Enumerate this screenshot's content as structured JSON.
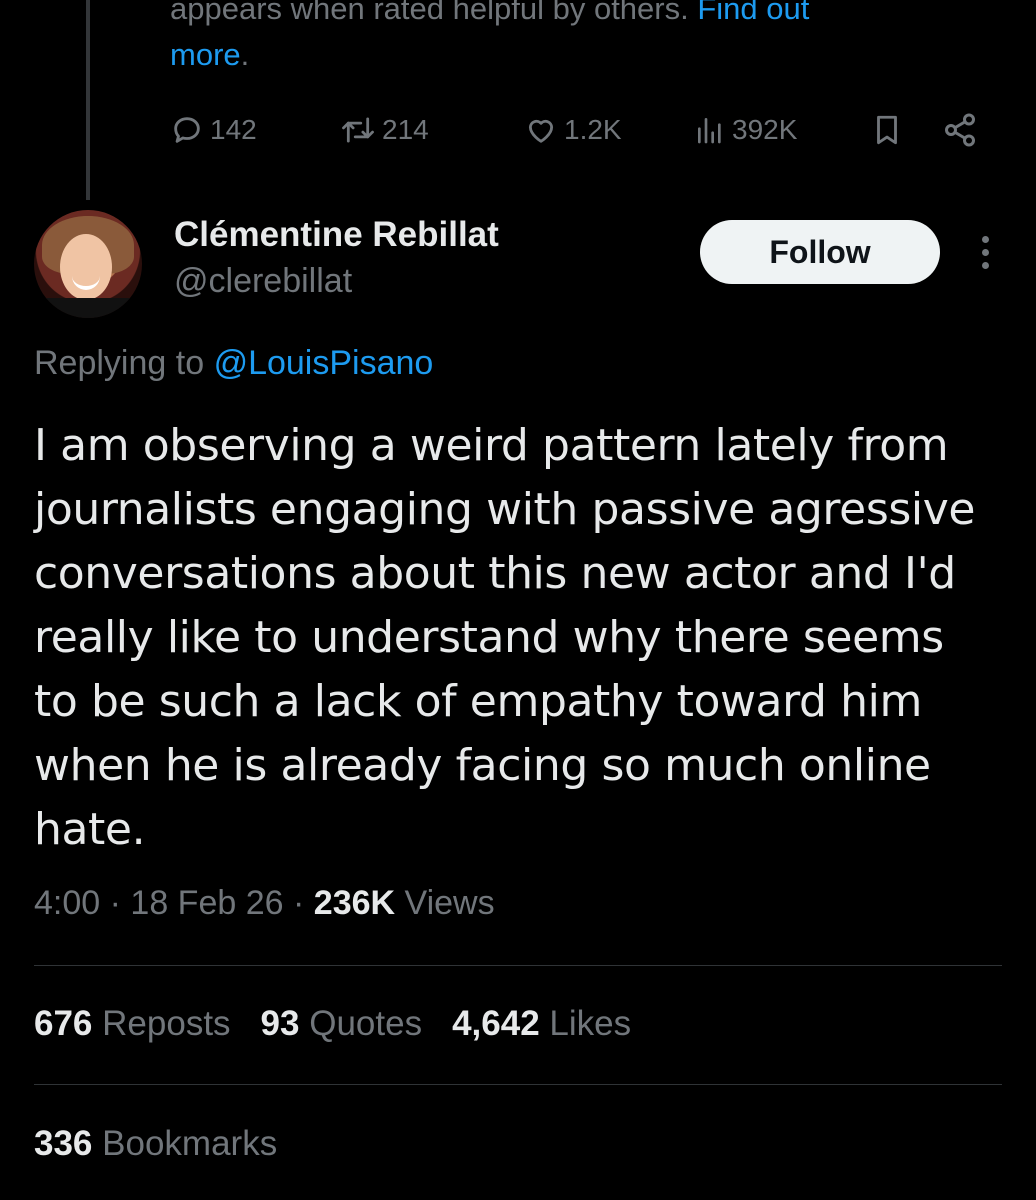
{
  "note": {
    "text_line1": "appears when rated helpful by others.",
    "link_find_out": "Find out",
    "link_more": "more",
    "period": "."
  },
  "parent_actions": {
    "replies": "142",
    "reposts": "214",
    "likes": "1.2K",
    "views": "392K",
    "icons": [
      "reply-icon",
      "repost-icon",
      "like-icon",
      "views-icon",
      "bookmark-icon",
      "share-icon"
    ]
  },
  "author": {
    "display_name": "Clémentine Rebillat",
    "handle": "@clerebillat",
    "follow_label": "Follow"
  },
  "reply_context": {
    "prefix": "Replying to",
    "mention": "@LouisPisano"
  },
  "tweet": {
    "lines": [
      "I am observing a weird pattern lately from",
      "journalists engaging with passive agressive",
      "conversations about this new actor and I'd",
      "really like to understand why there seems",
      "to be such a lack of empathy toward him",
      "when he is already facing so much online",
      "hate."
    ],
    "time": "4:00",
    "sep1": "·",
    "date": "18 Feb 26",
    "sep2": "·",
    "views_count": "236K",
    "views_label": "Views"
  },
  "stats": {
    "reposts_count": "676",
    "reposts_label": "Reposts",
    "quotes_count": "93",
    "quotes_label": "Quotes",
    "likes_count": "4,642",
    "likes_label": "Likes",
    "bookmarks_count": "336",
    "bookmarks_label": "Bookmarks"
  },
  "colors": {
    "background": "#000000",
    "text": "#e7e9ea",
    "muted": "#71767b",
    "link": "#1d9bf0",
    "divider": "#2f3336"
  }
}
